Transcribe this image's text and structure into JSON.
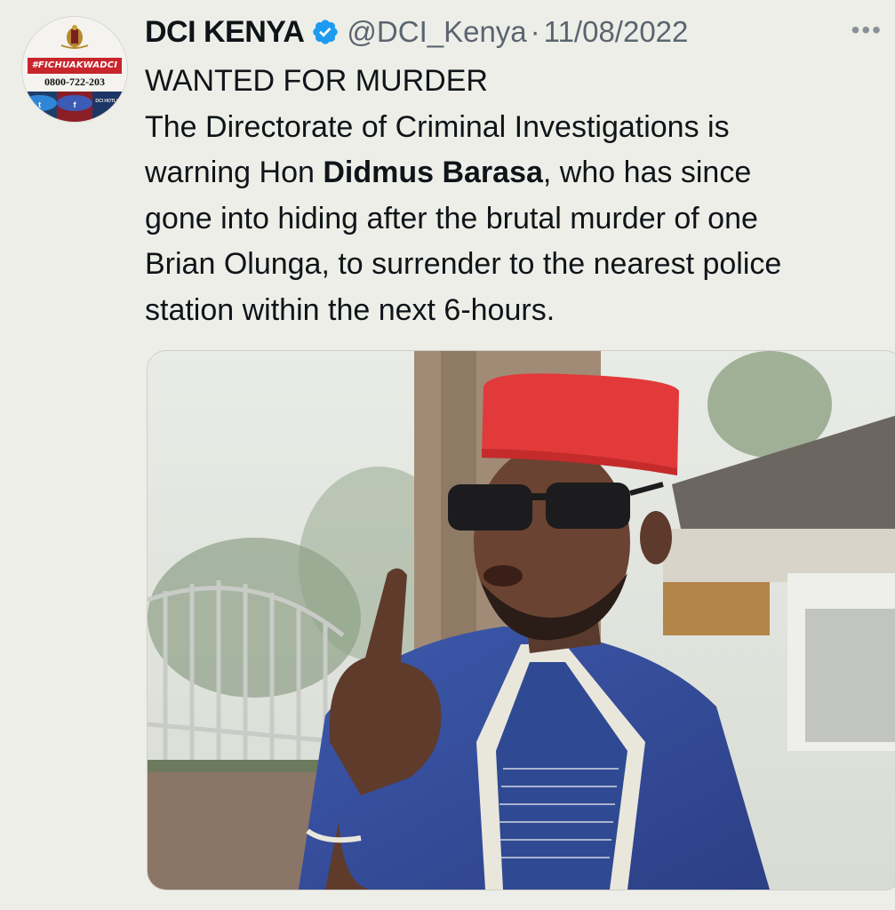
{
  "account": {
    "display_name": "DCI KENYA",
    "handle": "@DCI_Kenya",
    "separator": "·",
    "date": "11/08/2022",
    "verified_icon": "verified-badge-icon",
    "verified_color": "#1d9bf0"
  },
  "avatar": {
    "hashtag": "#FICHUAKWADCI",
    "phone": "0800-722-203",
    "mini_label": "DCI HOTLINE"
  },
  "more_menu": {
    "label": "•••",
    "icon": "more-options-icon"
  },
  "tweet": {
    "line1": "WANTED FOR MURDER",
    "line2": "The Directorate of Criminal Investigations is",
    "line3_pre": "warning Hon ",
    "line3_bold": "Didmus Barasa",
    "line3_post": ", who has since",
    "line4": "gone into hiding after the brutal murder of one",
    "line5": "Brian Olunga, to surrender to the nearest police",
    "line6": "station within the next 6-hours."
  },
  "media": {
    "description_icon": "photo-media",
    "colors": {
      "hat": "#e23a3a",
      "robe": "#3650a0",
      "sky": "#e3e6e0"
    }
  }
}
